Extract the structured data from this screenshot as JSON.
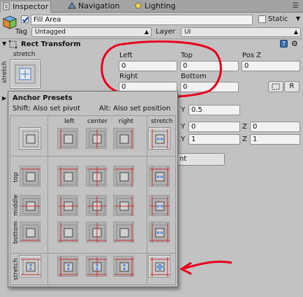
{
  "tabs": [
    {
      "label": "Inspector",
      "icon": "inspector-icon"
    },
    {
      "label": "Navigation",
      "icon": "navigation-icon"
    },
    {
      "label": "Lighting",
      "icon": "lighting-icon"
    }
  ],
  "object": {
    "name": "Fill Area",
    "active": true,
    "static_label": "Static",
    "tag_label": "Tag",
    "tag_value": "Untagged",
    "layer_label": "Layer",
    "layer_value": "UI"
  },
  "rect_transform": {
    "title": "Rect Transform",
    "anchor_caption": "stretch",
    "anchor_side_caption": "stretch",
    "fields": {
      "left_label": "Left",
      "left_value": "0",
      "top_label": "Top",
      "top_value": "0",
      "posz_label": "Pos Z",
      "posz_value": "0",
      "right_label": "Right",
      "right_value": "0",
      "bottom_label": "Bottom",
      "bottom_value": "0"
    },
    "r_button": "R",
    "pivot_y_label": "Y",
    "pivot_y_value": "0.5",
    "rot_y_label": "Y",
    "rot_y_value": "0",
    "rot_z_label": "Z",
    "rot_z_value": "0",
    "scale_y_label": "Y",
    "scale_y_value": "1",
    "scale_z_label": "Z",
    "scale_z_value": "1",
    "hidden_button_partial": "nt"
  },
  "anchor_presets": {
    "title": "Anchor Presets",
    "shift_hint": "Shift: Also set pivot",
    "alt_hint": "Alt: Also set position",
    "columns": [
      "left",
      "center",
      "right",
      "stretch"
    ],
    "rows": [
      "top",
      "middle",
      "bottom",
      "stretch"
    ],
    "selected": "stretch-stretch"
  },
  "annotation_color": "#e8001c"
}
